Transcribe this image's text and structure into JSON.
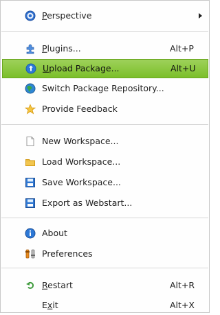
{
  "menu": {
    "items": [
      {
        "label_before": "",
        "mnemonic": "P",
        "label_after": "erspective",
        "shortcut": "",
        "submenu": true,
        "icon": "perspective-icon"
      },
      {
        "label_before": "",
        "mnemonic": "P",
        "label_after": "lugins...",
        "shortcut": "Alt+P",
        "submenu": false,
        "icon": "plugins-icon"
      },
      {
        "label_before": "",
        "mnemonic": "U",
        "label_after": "pload Package...",
        "shortcut": "Alt+U",
        "submenu": false,
        "icon": "upload-package-icon",
        "active": true
      },
      {
        "label_before": "Switch Package Repository...",
        "mnemonic": "",
        "label_after": "",
        "shortcut": "",
        "submenu": false,
        "icon": "globe-icon"
      },
      {
        "label_before": "Provide Feedback",
        "mnemonic": "",
        "label_after": "",
        "shortcut": "",
        "submenu": false,
        "icon": "star-icon"
      },
      {
        "label_before": "New Workspace...",
        "mnemonic": "",
        "label_after": "",
        "shortcut": "",
        "submenu": false,
        "icon": "new-document-icon"
      },
      {
        "label_before": "Load Workspace...",
        "mnemonic": "",
        "label_after": "",
        "shortcut": "",
        "submenu": false,
        "icon": "folder-icon"
      },
      {
        "label_before": "Save Workspace...",
        "mnemonic": "",
        "label_after": "",
        "shortcut": "",
        "submenu": false,
        "icon": "save-icon"
      },
      {
        "label_before": "Export as Webstart...",
        "mnemonic": "",
        "label_after": "",
        "shortcut": "",
        "submenu": false,
        "icon": "export-icon"
      },
      {
        "label_before": "About",
        "mnemonic": "",
        "label_after": "",
        "shortcut": "",
        "submenu": false,
        "icon": "info-icon"
      },
      {
        "label_before": "Preferences",
        "mnemonic": "",
        "label_after": "",
        "shortcut": "",
        "submenu": false,
        "icon": "preferences-icon"
      },
      {
        "label_before": "",
        "mnemonic": "R",
        "label_after": "estart",
        "shortcut": "Alt+R",
        "submenu": false,
        "icon": "restart-icon"
      },
      {
        "label_before": "E",
        "mnemonic": "x",
        "label_after": "it",
        "shortcut": "Alt+X",
        "submenu": false,
        "icon": "none"
      }
    ]
  }
}
